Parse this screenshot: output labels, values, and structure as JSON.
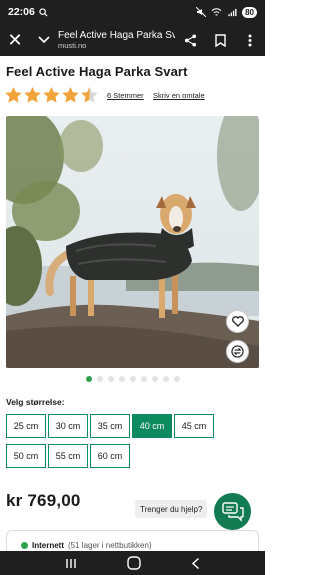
{
  "status_bar": {
    "time": "22:06",
    "battery": "80"
  },
  "browser": {
    "tab_title": "Feel Active Haga Parka Svart",
    "url": "musti.no"
  },
  "product": {
    "title": "Feel Active Haga Parka Svart",
    "rating": 4.5,
    "reviews_link": "6 Stemmer",
    "write_review_link": "Skriv en omtale"
  },
  "gallery": {
    "slide_count": 9,
    "active_slide": 1
  },
  "size_selector": {
    "label": "Velg størrelse:",
    "options": [
      "25 cm",
      "30 cm",
      "35 cm",
      "40 cm",
      "45 cm",
      "50 cm",
      "55 cm",
      "60 cm"
    ],
    "selected": "40 cm"
  },
  "price": "kr 769,00",
  "help": {
    "bubble_text": "Trenger du hjelp?"
  },
  "info_strip": {
    "title": "Internett",
    "subtitle": "(51 lager i nettbutikken)"
  },
  "colors": {
    "accent": "#0e8a5f",
    "dark_bar": "#1f1f1f",
    "star": "#f2a33a"
  }
}
